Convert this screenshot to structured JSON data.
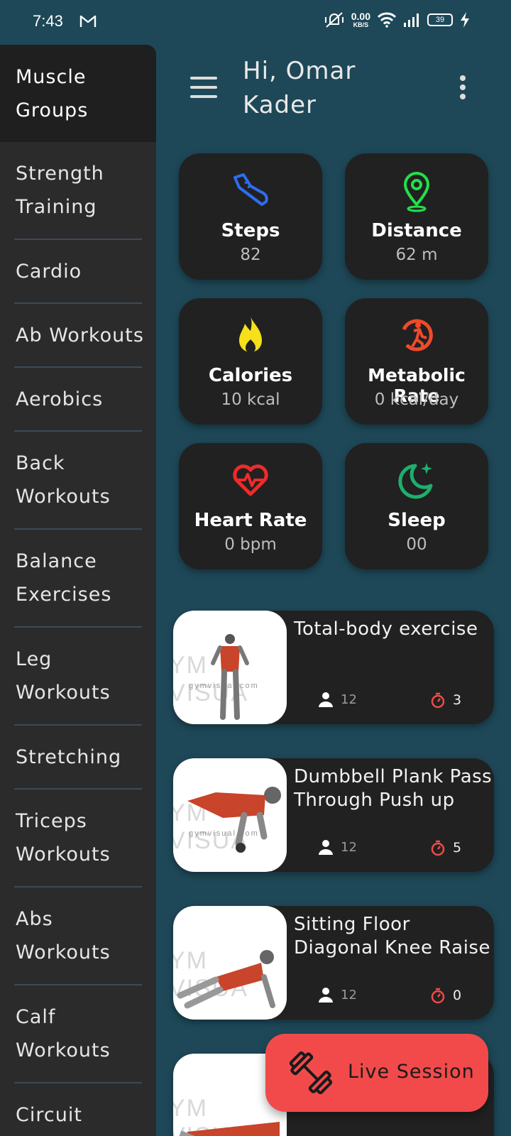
{
  "status_bar": {
    "time": "7:43",
    "net_speed_value": "0.00",
    "net_speed_unit": "KB/S",
    "battery": "39"
  },
  "drawer": {
    "items": [
      {
        "label": "Muscle Groups"
      },
      {
        "label": "Strength Training"
      },
      {
        "label": "Cardio"
      },
      {
        "label": "Ab Workouts"
      },
      {
        "label": "Aerobics"
      },
      {
        "label": "Back Workouts"
      },
      {
        "label": "Balance Exercises"
      },
      {
        "label": "Leg Workouts"
      },
      {
        "label": "Stretching"
      },
      {
        "label": "Triceps Workouts"
      },
      {
        "label": "Abs Workouts"
      },
      {
        "label": "Calf Workouts"
      },
      {
        "label": "Circuit"
      }
    ]
  },
  "header": {
    "greeting": "Hi, Omar Kader"
  },
  "stats": [
    {
      "title": "Steps",
      "value": "82",
      "icon": "shoe-icon",
      "color": "#2f6df2"
    },
    {
      "title": "Distance",
      "value": "62 m",
      "icon": "location-pin-icon",
      "color": "#22e04a"
    },
    {
      "title": "Calories",
      "value": "10 kcal",
      "icon": "flame-icon",
      "color": "#f5e01a"
    },
    {
      "title": "Metabolic Rate",
      "value": "0 kcal/day",
      "icon": "runner-icon",
      "color": "#f04a2a"
    },
    {
      "title": "Heart Rate",
      "value": "0 bpm",
      "icon": "heart-pulse-icon",
      "color": "#f02a2a"
    },
    {
      "title": "Sleep",
      "value": "00",
      "icon": "moon-icon",
      "color": "#1fae6e"
    }
  ],
  "exercises": [
    {
      "name": "Total-body exercise",
      "people": "12",
      "timer": "3",
      "watermark": "YM VISUA",
      "watermark2": "gymvisual.com"
    },
    {
      "name": "Dumbbell Plank Pass Through Push up",
      "people": "12",
      "timer": "5",
      "watermark": "YM VISUA",
      "watermark2": "gymvisual.com"
    },
    {
      "name": "Sitting Floor Diagonal Knee Raise",
      "people": "12",
      "timer": "0",
      "watermark": "YM VISUA",
      "watermark2": ""
    },
    {
      "name": "",
      "people": "",
      "timer": "",
      "watermark": "YM VISUA",
      "watermark2": ""
    }
  ],
  "fab": {
    "label": "Live Session",
    "icon": "dumbbell-icon",
    "color": "#f24a4a"
  },
  "colors": {
    "background": "#1e4858",
    "card": "#212121",
    "drawer": "#2b2b2b"
  }
}
